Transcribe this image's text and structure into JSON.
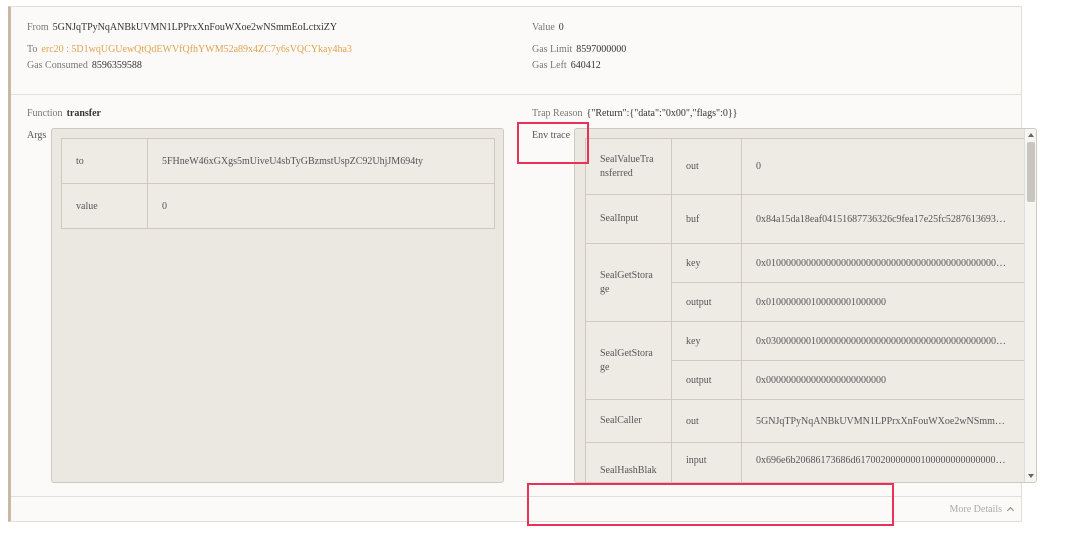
{
  "details": {
    "from_label": "From",
    "from_value": "5GNJqTPyNqANBkUVMN1LPPrxXnFouWXoe2wNSmmEoLctxiZY",
    "to_label": "To",
    "to_value": "erc20 : 5D1wqUGUewQtQdEWVfQfhYWM52a89x4ZC7y6sVQCYkay4ha3",
    "gas_consumed_label": "Gas Consumed",
    "gas_consumed_value": "8596359588",
    "value_label": "Value",
    "value_value": "0",
    "gas_limit_label": "Gas Limit",
    "gas_limit_value": "8597000000",
    "gas_left_label": "Gas Left",
    "gas_left_value": "640412"
  },
  "function": {
    "label": "Function",
    "name": "transfer"
  },
  "trap": {
    "label": "Trap Reason",
    "value": "{\"Return\":{\"data\":\"0x00\",\"flags\":0}}"
  },
  "args": {
    "label": "Args",
    "rows": [
      {
        "key": "to",
        "value": "5FHneW46xGXgs5mUiveU4sbTyGBzmstUspZC92UhjJM694ty"
      },
      {
        "key": "value",
        "value": "0"
      }
    ]
  },
  "env_trace": {
    "label": "Env trace",
    "rows": [
      {
        "name": "SealValueTransferred",
        "params": [
          {
            "param": "out",
            "value": "0"
          }
        ]
      },
      {
        "name": "SealInput",
        "params": [
          {
            "param": "buf",
            "value": "0x84a15da18eaf04151687736326c9fea17e25fc5287613693…"
          }
        ]
      },
      {
        "name": "SealGetStorage",
        "params": [
          {
            "param": "key",
            "value": "0x0100000000000000000000000000000000000000000000000…"
          },
          {
            "param": "output",
            "value": "0x010000000100000001000000"
          }
        ]
      },
      {
        "name": "SealGetStorage",
        "params": [
          {
            "param": "key",
            "value": "0x0300000001000000000000000000000000000000000000000…"
          },
          {
            "param": "output",
            "value": "0x000000000000000000000000"
          }
        ]
      },
      {
        "name": "SealCaller",
        "params": [
          {
            "param": "out",
            "value": "5GNJqTPyNqANBkUVMN1LPPrxXnFouWXoe2wNSmm…"
          }
        ]
      },
      {
        "name": "SealHashBlak",
        "params": [
          {
            "param": "input",
            "value": "0x696e6b20686173686d61700200000001000000000000000…"
          }
        ]
      }
    ]
  },
  "footer": {
    "more_details": "More Details",
    "chevron_icon": "chevron-up-icon"
  },
  "highlight_color": "#e8325a"
}
